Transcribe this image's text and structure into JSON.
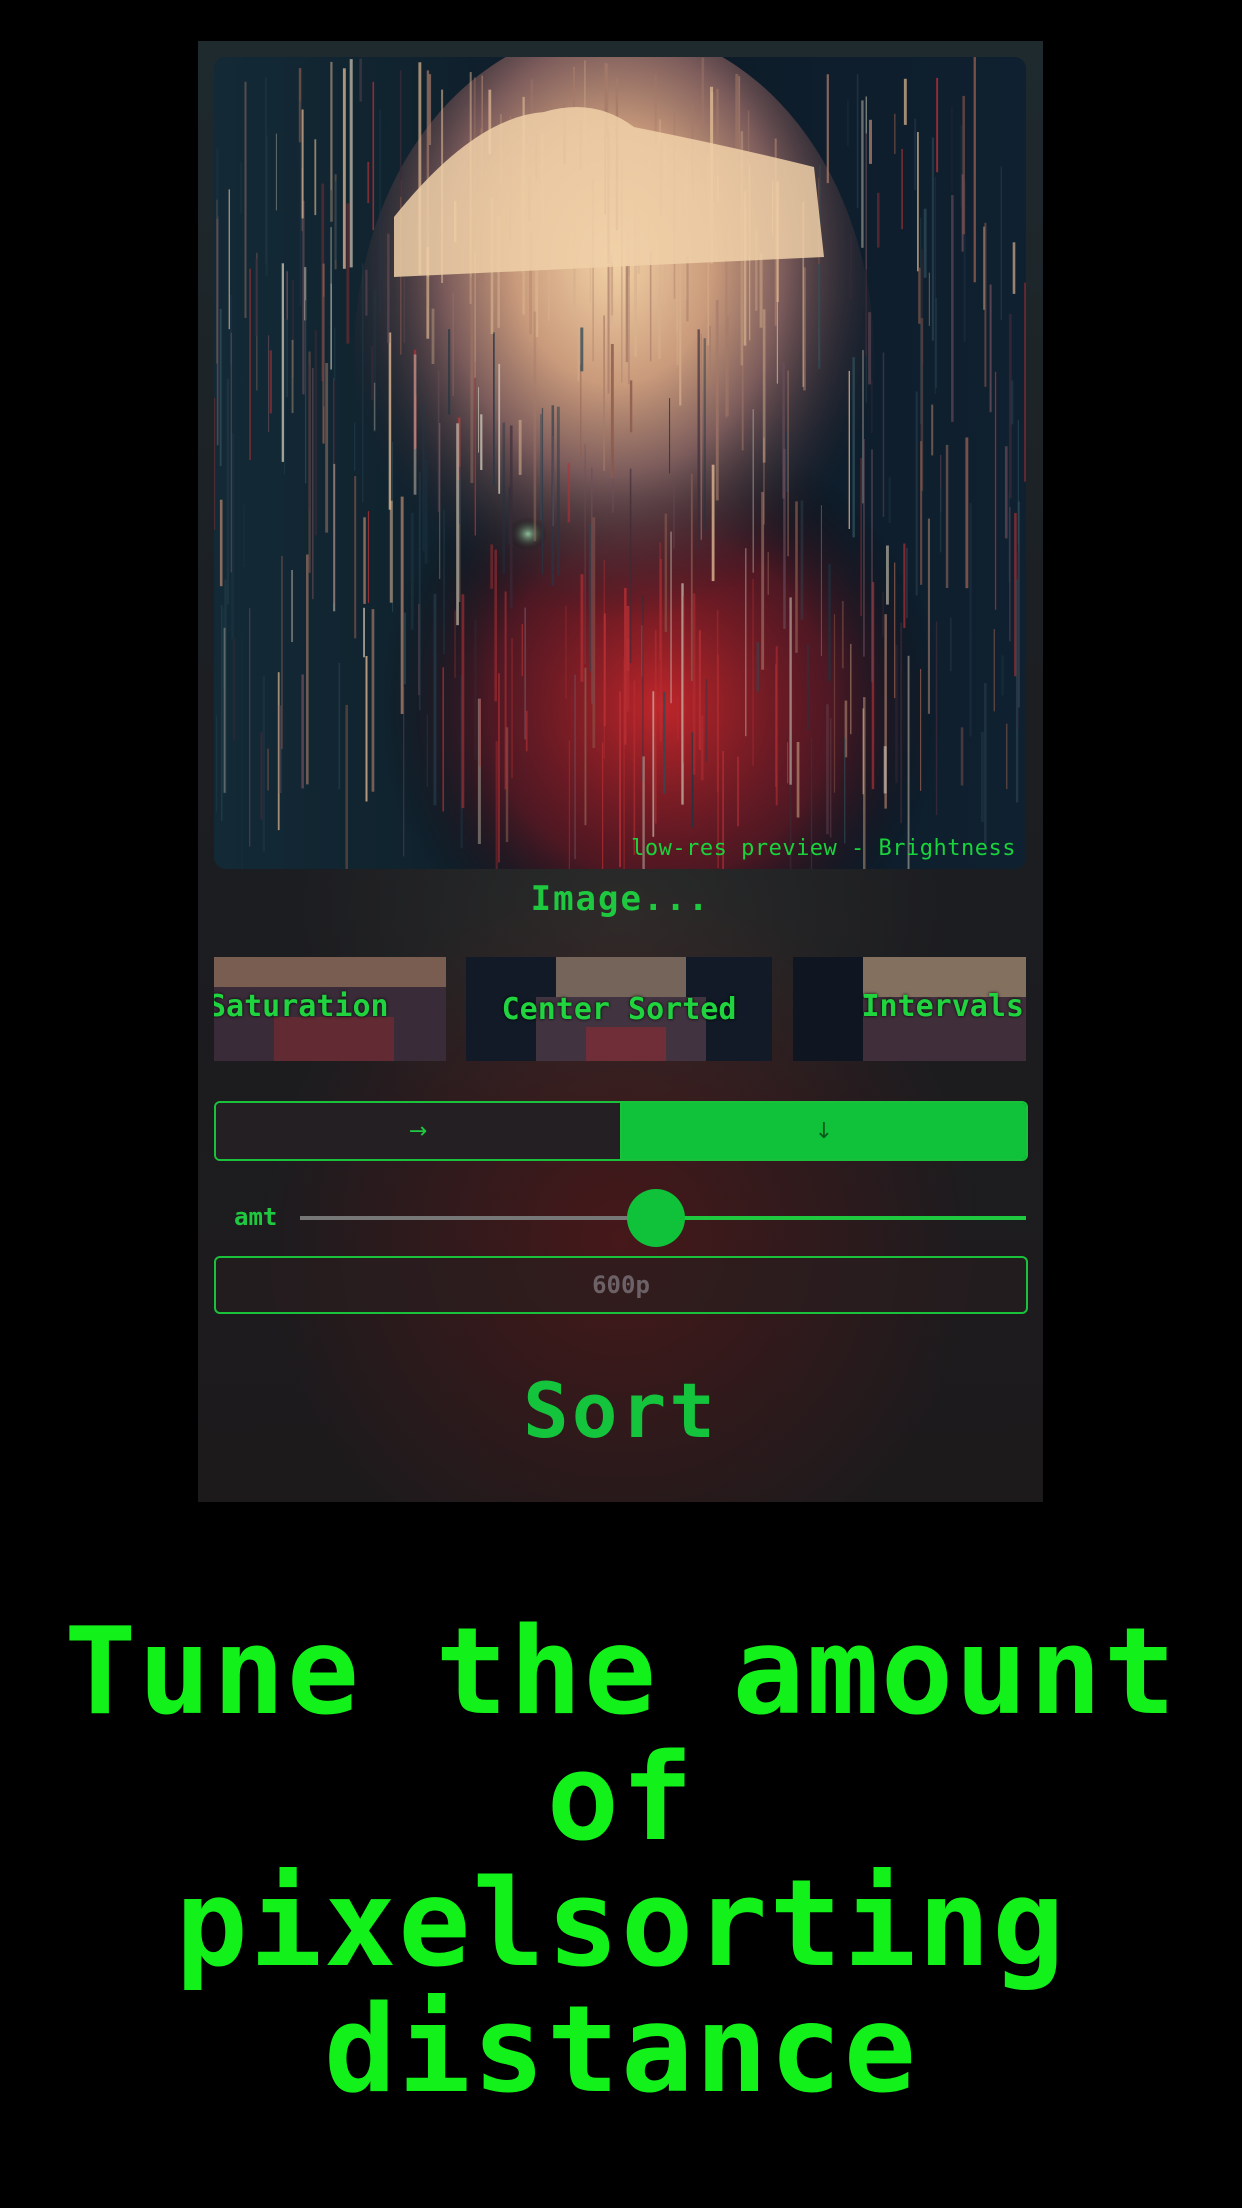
{
  "colors": {
    "accent": "#10c13a",
    "caption": "#12f21a",
    "background": "#000000"
  },
  "preview": {
    "label": "low-res preview - Brightness"
  },
  "image_button": {
    "label": "Image..."
  },
  "modes": [
    {
      "label": "Saturation"
    },
    {
      "label": "Center Sorted"
    },
    {
      "label": "Intervals"
    }
  ],
  "direction": {
    "options": [
      {
        "icon": "arrow-right-icon",
        "glyph": "→",
        "selected": false
      },
      {
        "icon": "arrow-down-icon",
        "glyph": "↓",
        "selected": true
      }
    ]
  },
  "amount": {
    "label": "amt",
    "value": 0.49
  },
  "distance": {
    "placeholder": "600p"
  },
  "sort_button": {
    "label": "Sort"
  },
  "caption": {
    "lines": [
      "Tune the amount",
      "of",
      "pixelsorting",
      "distance"
    ]
  }
}
